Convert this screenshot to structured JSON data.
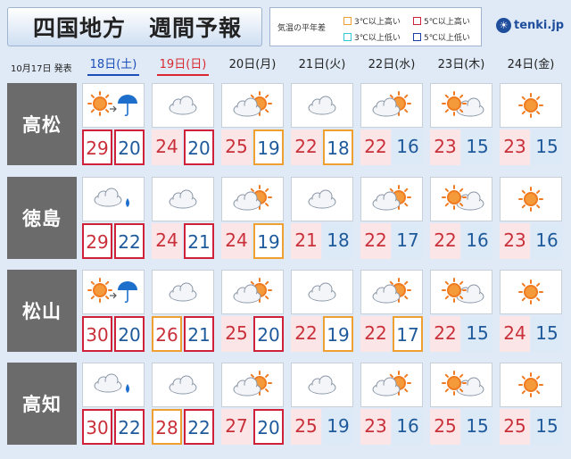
{
  "header": {
    "title": "四国地方　週間予報",
    "legend_label": "気温の平年差",
    "legend_items": [
      {
        "text": "3℃以上高い",
        "color": "#f0a030"
      },
      {
        "text": "5℃以上高い",
        "color": "#d0213a"
      },
      {
        "text": "3℃以上低い",
        "color": "#33c8d8"
      },
      {
        "text": "5℃以上低い",
        "color": "#1d3fa8"
      }
    ],
    "logo_text": "tenki.jp",
    "announce": "10月17日 発表"
  },
  "days": [
    {
      "label": "18日(土)",
      "kind": "sat"
    },
    {
      "label": "19日(日)",
      "kind": "sun"
    },
    {
      "label": "20日(月)",
      "kind": "wd"
    },
    {
      "label": "21日(火)",
      "kind": "wd"
    },
    {
      "label": "22日(水)",
      "kind": "wd"
    },
    {
      "label": "23日(木)",
      "kind": "wd"
    },
    {
      "label": "24日(金)",
      "kind": "wd"
    }
  ],
  "cities": [
    {
      "name": "高松",
      "cells": [
        {
          "icon": "sun-then-rain-icon",
          "hi": "29",
          "lo": "20",
          "hb": "red",
          "lb": "red"
        },
        {
          "icon": "cloud-icon",
          "hi": "24",
          "lo": "20",
          "hb": "",
          "lb": "red"
        },
        {
          "icon": "cloud-sun-icon",
          "hi": "25",
          "lo": "19",
          "hb": "",
          "lb": "orange"
        },
        {
          "icon": "cloud-icon",
          "hi": "22",
          "lo": "18",
          "hb": "",
          "lb": "orange"
        },
        {
          "icon": "cloud-sun-icon",
          "hi": "22",
          "lo": "16",
          "hb": "",
          "lb": ""
        },
        {
          "icon": "sun-cloud-icon",
          "hi": "23",
          "lo": "15",
          "hb": "",
          "lb": ""
        },
        {
          "icon": "sun-icon",
          "hi": "23",
          "lo": "15",
          "hb": "",
          "lb": ""
        }
      ]
    },
    {
      "name": "徳島",
      "cells": [
        {
          "icon": "cloud-rain-icon",
          "hi": "29",
          "lo": "22",
          "hb": "red",
          "lb": "red"
        },
        {
          "icon": "cloud-icon",
          "hi": "24",
          "lo": "21",
          "hb": "",
          "lb": "red"
        },
        {
          "icon": "cloud-sun-icon",
          "hi": "24",
          "lo": "19",
          "hb": "",
          "lb": "orange"
        },
        {
          "icon": "cloud-icon",
          "hi": "21",
          "lo": "18",
          "hb": "",
          "lb": ""
        },
        {
          "icon": "cloud-sun-icon",
          "hi": "22",
          "lo": "17",
          "hb": "",
          "lb": ""
        },
        {
          "icon": "sun-cloud-icon",
          "hi": "22",
          "lo": "16",
          "hb": "",
          "lb": ""
        },
        {
          "icon": "sun-icon",
          "hi": "23",
          "lo": "16",
          "hb": "",
          "lb": ""
        }
      ]
    },
    {
      "name": "松山",
      "cells": [
        {
          "icon": "sun-then-rain-icon",
          "hi": "30",
          "lo": "20",
          "hb": "red",
          "lb": "red"
        },
        {
          "icon": "cloud-icon",
          "hi": "26",
          "lo": "21",
          "hb": "orange",
          "lb": "red"
        },
        {
          "icon": "cloud-sun-icon",
          "hi": "25",
          "lo": "20",
          "hb": "",
          "lb": "red"
        },
        {
          "icon": "cloud-icon",
          "hi": "22",
          "lo": "19",
          "hb": "",
          "lb": "orange"
        },
        {
          "icon": "cloud-sun-icon",
          "hi": "22",
          "lo": "17",
          "hb": "",
          "lb": "orange"
        },
        {
          "icon": "sun-cloud-icon",
          "hi": "22",
          "lo": "15",
          "hb": "",
          "lb": ""
        },
        {
          "icon": "sun-icon",
          "hi": "24",
          "lo": "15",
          "hb": "",
          "lb": ""
        }
      ]
    },
    {
      "name": "高知",
      "cells": [
        {
          "icon": "cloud-rain-icon",
          "hi": "30",
          "lo": "22",
          "hb": "red",
          "lb": "red"
        },
        {
          "icon": "cloud-icon",
          "hi": "28",
          "lo": "22",
          "hb": "orange",
          "lb": "red"
        },
        {
          "icon": "cloud-sun-icon",
          "hi": "27",
          "lo": "20",
          "hb": "",
          "lb": "red"
        },
        {
          "icon": "cloud-icon",
          "hi": "25",
          "lo": "19",
          "hb": "",
          "lb": ""
        },
        {
          "icon": "cloud-sun-icon",
          "hi": "23",
          "lo": "16",
          "hb": "",
          "lb": ""
        },
        {
          "icon": "sun-cloud-icon",
          "hi": "25",
          "lo": "15",
          "hb": "",
          "lb": ""
        },
        {
          "icon": "sun-icon",
          "hi": "25",
          "lo": "15",
          "hb": "",
          "lb": ""
        }
      ]
    }
  ]
}
